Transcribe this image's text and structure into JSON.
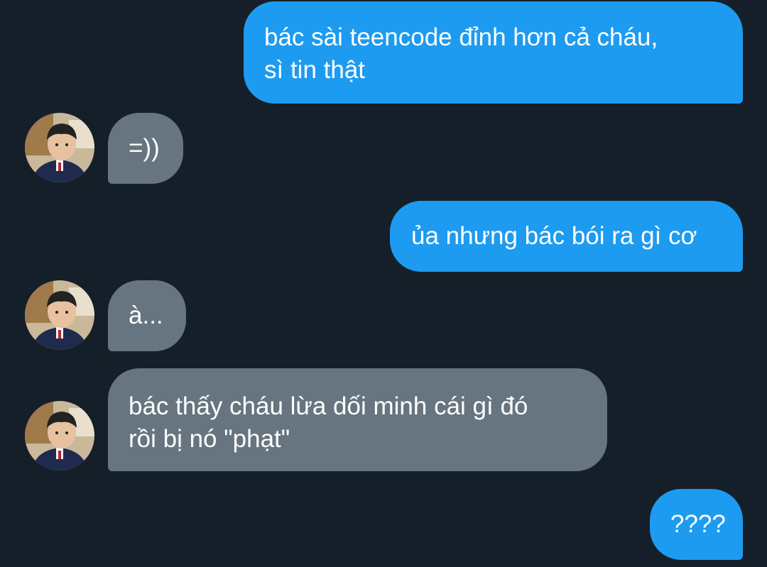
{
  "conversation": {
    "messages": [
      {
        "direction": "outgoing",
        "text": "bác sài teencode đỉnh hơn cả cháu,\nsì tin thật"
      },
      {
        "direction": "incoming",
        "text": "=))"
      },
      {
        "direction": "outgoing",
        "text": "ủa nhưng bác bói ra gì cơ"
      },
      {
        "direction": "incoming",
        "text": "à..."
      },
      {
        "direction": "incoming",
        "text": "bác thấy cháu lừa dối minh cái gì đó\nrồi bị nó \"phạt\""
      },
      {
        "direction": "outgoing",
        "text": "????"
      }
    ]
  },
  "colors": {
    "background": "#151f29",
    "outgoing_bubble": "#1d9bf0",
    "incoming_bubble": "#66757f",
    "text": "#ffffff"
  },
  "icons": {
    "avatar": "child-portrait-avatar"
  }
}
